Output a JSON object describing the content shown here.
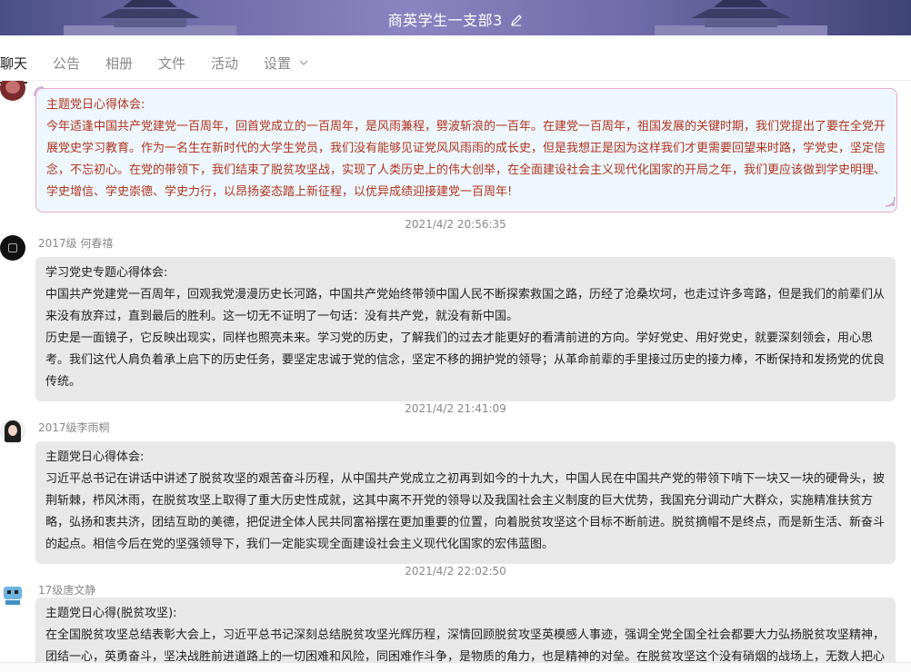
{
  "header": {
    "title": "商英学生一支部3"
  },
  "tabs": [
    {
      "label": "聊天"
    },
    {
      "label": "公告"
    },
    {
      "label": "相册"
    },
    {
      "label": "文件"
    },
    {
      "label": "活动"
    },
    {
      "label": "设置"
    }
  ],
  "messages": [
    {
      "sender": "",
      "lines": [
        "主题党日心得体会:",
        "今年适逢中国共产党建党一百周年，回首党成立的一百周年，是风雨兼程，劈波斩浪的一百年。在建党一百周年，祖国发展的关键时期，我们党提出了要在全党开展党史学习教育。作为一名生在新时代的大学生党员，我们没有能够见证党风风雨雨的成长史，但是我想正是因为这样我们才更需要回望来时路，学党史，坚定信念，不忘初心。在党的带领下，我们结束了脱贫攻坚战，实现了人类历史上的伟大创举，在全面建设社会主义现代化国家的开局之年，我们更应该做到学史明理、学史增信、学史崇德、学史力行，以昂扬姿态踏上新征程，以优异成绩迎接建党一百周年!"
      ]
    },
    {
      "time": "2021/4/2 20:56:35",
      "sender": "2017级  何春禧",
      "lines": [
        "学习党史专题心得体会:",
        "中国共产党建党一百周年，回观我党漫漫历史长河路，中国共产党始终带领中国人民不断探索救国之路，历经了沧桑坎坷，也走过许多弯路，但是我们的前辈们从来没有放弃过，直到最后的胜利。这一切无不证明了一句话：没有共产党，就没有新中国。",
        "历史是一面镜子，它反映出现实，同样也照亮未来。学习党的历史，了解我们的过去才能更好的看清前进的方向。学好党史、用好党史，就要深刻领会，用心思考。我们这代人肩负着承上启下的历史任务，要坚定忠诚于党的信念，坚定不移的拥护党的领导；从革命前辈的手里接过历史的接力棒，不断保持和发扬党的优良传统。"
      ]
    },
    {
      "time": "2021/4/2 21:41:09",
      "sender": "2017级李雨桐",
      "lines": [
        "主题党日心得体会:",
        "习近平总书记在讲话中讲述了脱贫攻坚的艰苦奋斗历程，从中国共产党成立之初再到如今的十九大，中国人民在中国共产党的带领下啃下一块又一块的硬骨头，披荆斩棘，栉风沐雨，在脱贫攻坚上取得了重大历史性成就，这其中离不开党的领导以及我国社会主义制度的巨大优势，我国充分调动广大群众，实施精准扶贫方略，弘扬和衷共济，团结互助的美德，把促进全体人民共同富裕摆在更加重要的位置，向着脱贫攻坚这个目标不断前进。脱贫摘帽不是终点，而是新生活、新奋斗的起点。相信今后在党的坚强领导下，我们一定能实现全面建设社会主义现代化国家的宏伟蓝图。"
      ]
    },
    {
      "time": "2021/4/2 22:02:50",
      "sender": "17级唐文静",
      "lines": [
        "主题党日心得(脱贫攻坚):",
        "在全国脱贫攻坚总结表彰大会上，习近平总书记深刻总结脱贫攻坚光辉历程，深情回顾脱贫攻坚英模感人事迹，强调全党全国全社会都要大力弘扬脱贫攻坚精神，团结一心，英勇奋斗，坚决战胜前进道路上的一切困难和风险，同困难作斗争，是物质的角力，也是精神的对垒。在脱贫攻坚这个没有硝烟的战场上，无数人把心"
      ]
    }
  ]
}
